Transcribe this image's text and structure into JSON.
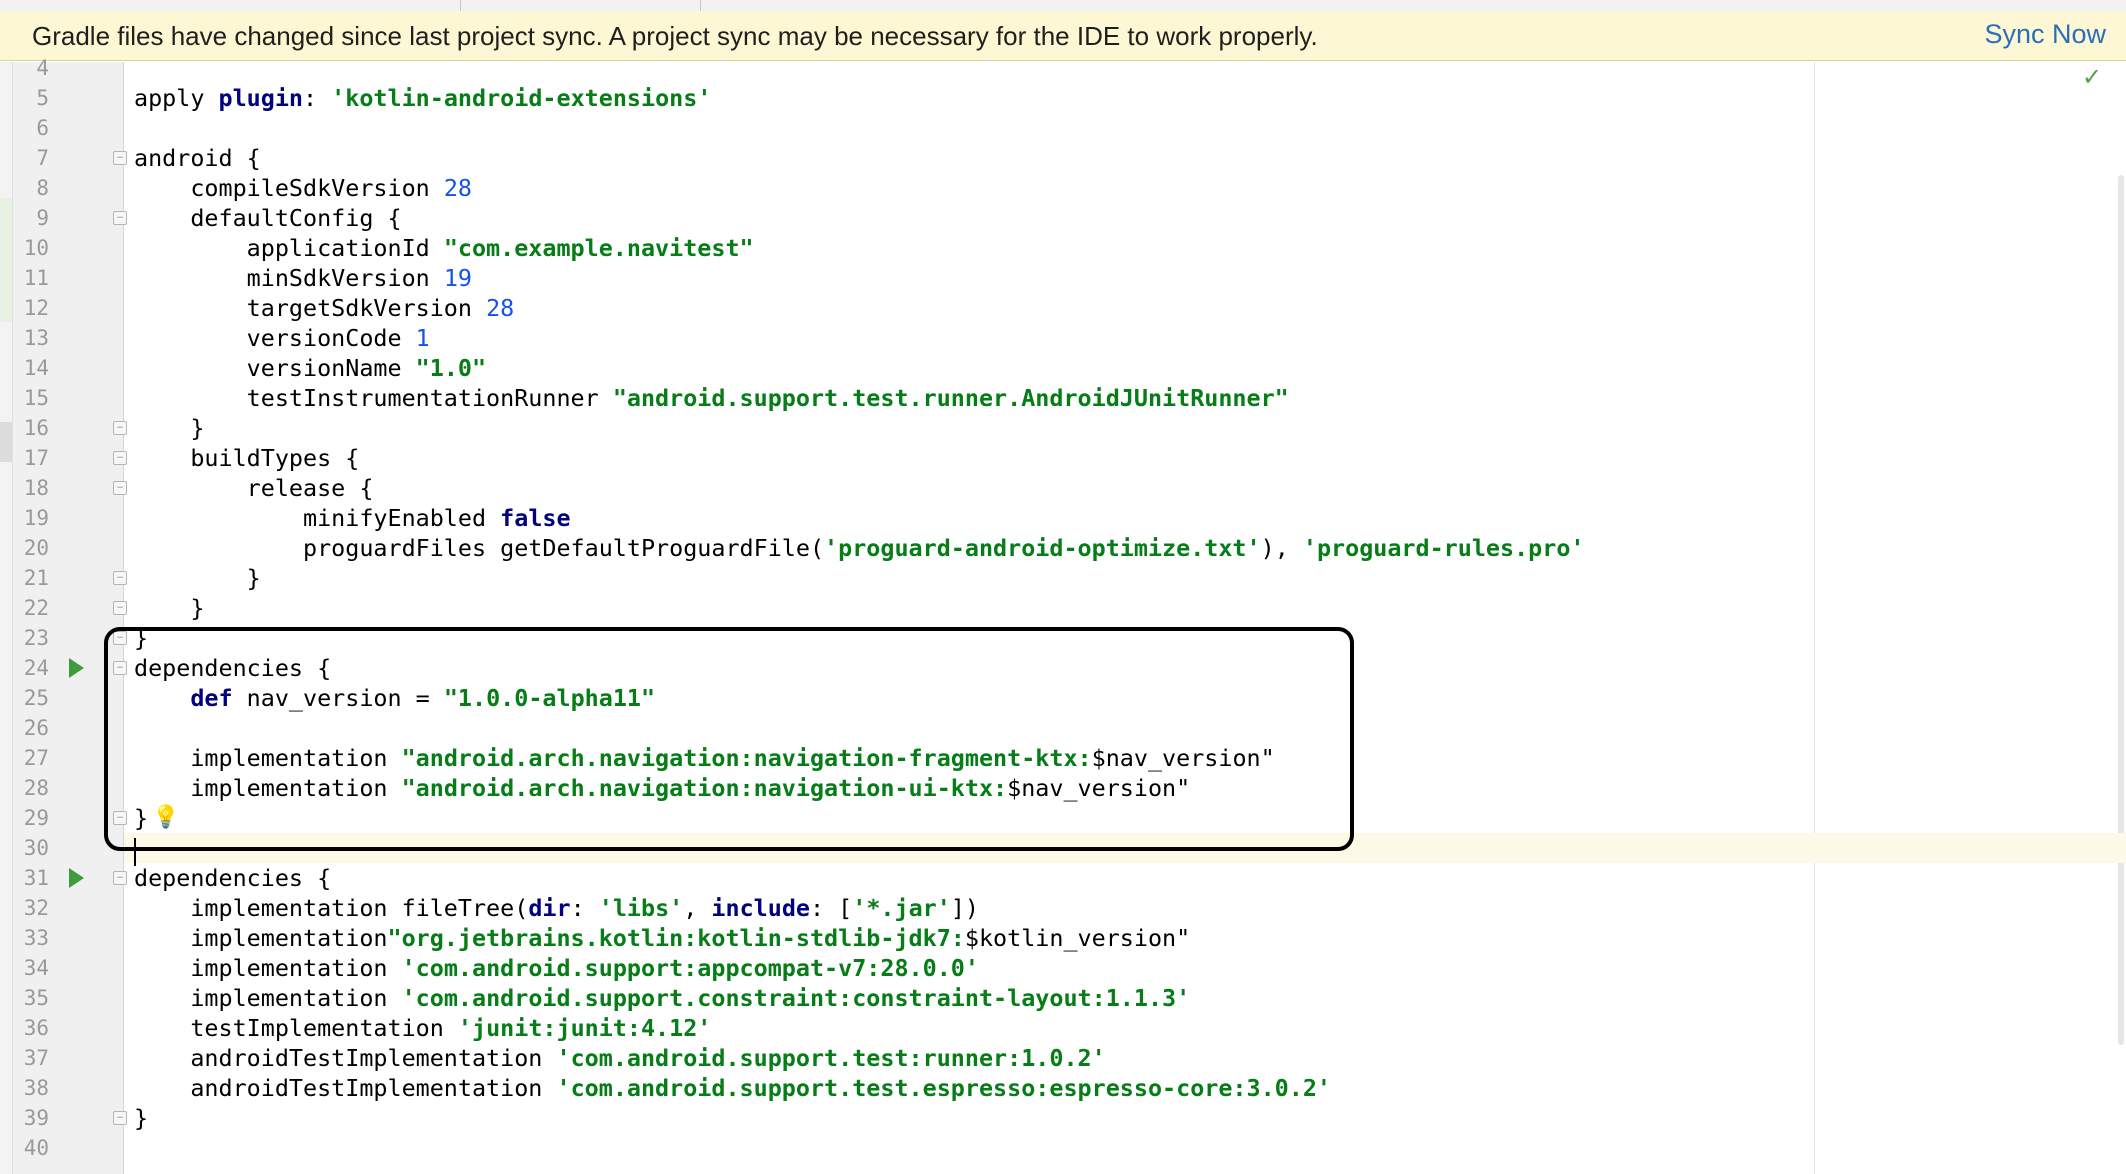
{
  "banner": {
    "message": "Gradle files have changed since last project sync. A project sync may be necessary for the IDE to work properly.",
    "action_label": "Sync Now"
  },
  "colors": {
    "banner_background": "#fdf8d3",
    "link": "#2a6ebb",
    "keyword": "#000080",
    "string": "#067d17",
    "number": "#1750eb",
    "gutter_background": "#f0f0f0",
    "current_line": "#fcfae6"
  },
  "icons": {
    "fold": "fold-marker-icon",
    "run": "run-gutter-icon",
    "bulb": "lightbulb-icon",
    "check": "check-icon"
  },
  "editor": {
    "current_line": "30",
    "lines": [
      {
        "n": "4",
        "tokens": []
      },
      {
        "n": "5",
        "tokens": [
          [
            "p",
            "apply "
          ],
          [
            "k",
            "plugin"
          ],
          [
            "p",
            ": "
          ],
          [
            "s",
            "'kotlin-android-extensions'"
          ]
        ]
      },
      {
        "n": "6",
        "tokens": []
      },
      {
        "n": "7",
        "fold": true,
        "tokens": [
          [
            "p",
            "android {"
          ]
        ]
      },
      {
        "n": "8",
        "tokens": [
          [
            "p",
            "    compileSdkVersion "
          ],
          [
            "n",
            "28"
          ]
        ]
      },
      {
        "n": "9",
        "fold": true,
        "tokens": [
          [
            "p",
            "    defaultConfig {"
          ]
        ]
      },
      {
        "n": "10",
        "tokens": [
          [
            "p",
            "        applicationId "
          ],
          [
            "s",
            "\"com.example.navitest\""
          ]
        ]
      },
      {
        "n": "11",
        "tokens": [
          [
            "p",
            "        minSdkVersion "
          ],
          [
            "n",
            "19"
          ]
        ]
      },
      {
        "n": "12",
        "tokens": [
          [
            "p",
            "        targetSdkVersion "
          ],
          [
            "n",
            "28"
          ]
        ]
      },
      {
        "n": "13",
        "tokens": [
          [
            "p",
            "        versionCode "
          ],
          [
            "n",
            "1"
          ]
        ]
      },
      {
        "n": "14",
        "tokens": [
          [
            "p",
            "        versionName "
          ],
          [
            "s",
            "\"1.0\""
          ]
        ]
      },
      {
        "n": "15",
        "tokens": [
          [
            "p",
            "        testInstrumentationRunner "
          ],
          [
            "s",
            "\"android.support.test.runner.AndroidJUnitRunner\""
          ]
        ]
      },
      {
        "n": "16",
        "fold": true,
        "tokens": [
          [
            "p",
            "    }"
          ]
        ]
      },
      {
        "n": "17",
        "fold": true,
        "tokens": [
          [
            "p",
            "    buildTypes {"
          ]
        ]
      },
      {
        "n": "18",
        "fold": true,
        "tokens": [
          [
            "p",
            "        release {"
          ]
        ]
      },
      {
        "n": "19",
        "tokens": [
          [
            "p",
            "            minifyEnabled "
          ],
          [
            "k",
            "false"
          ]
        ]
      },
      {
        "n": "20",
        "tokens": [
          [
            "p",
            "            proguardFiles getDefaultProguardFile("
          ],
          [
            "s",
            "'proguard-android-optimize.txt'"
          ],
          [
            "p",
            "), "
          ],
          [
            "s",
            "'proguard-rules.pro'"
          ]
        ]
      },
      {
        "n": "21",
        "fold": true,
        "tokens": [
          [
            "p",
            "        }"
          ]
        ]
      },
      {
        "n": "22",
        "fold": true,
        "tokens": [
          [
            "p",
            "    }"
          ]
        ]
      },
      {
        "n": "23",
        "fold": true,
        "tokens": [
          [
            "p",
            "}"
          ]
        ]
      },
      {
        "n": "24",
        "fold": true,
        "run": true,
        "tokens": [
          [
            "p",
            "dependencies {"
          ]
        ]
      },
      {
        "n": "25",
        "tokens": [
          [
            "p",
            "    "
          ],
          [
            "k",
            "def"
          ],
          [
            "p",
            " nav_version = "
          ],
          [
            "s",
            "\"1.0.0-alpha11\""
          ]
        ]
      },
      {
        "n": "26",
        "tokens": []
      },
      {
        "n": "27",
        "tokens": [
          [
            "p",
            "    implementation "
          ],
          [
            "s",
            "\"android.arch.navigation:navigation-fragment-ktx:"
          ],
          [
            "p",
            "$nav_version\""
          ]
        ]
      },
      {
        "n": "28",
        "tokens": [
          [
            "p",
            "    implementation "
          ],
          [
            "s",
            "\"android.arch.navigation:navigation-ui-ktx:"
          ],
          [
            "p",
            "$nav_version\""
          ]
        ]
      },
      {
        "n": "29",
        "fold": true,
        "bulb": true,
        "tokens": [
          [
            "p",
            "}"
          ]
        ]
      },
      {
        "n": "30",
        "tokens": []
      },
      {
        "n": "31",
        "fold": true,
        "run": true,
        "tokens": [
          [
            "p",
            "dependencies {"
          ]
        ]
      },
      {
        "n": "32",
        "tokens": [
          [
            "p",
            "    implementation fileTree("
          ],
          [
            "k",
            "dir"
          ],
          [
            "p",
            ": "
          ],
          [
            "s",
            "'libs'"
          ],
          [
            "p",
            ", "
          ],
          [
            "k",
            "include"
          ],
          [
            "p",
            ": ["
          ],
          [
            "s",
            "'*.jar'"
          ],
          [
            "p",
            "])"
          ]
        ]
      },
      {
        "n": "33",
        "tokens": [
          [
            "p",
            "    implementation"
          ],
          [
            "s",
            "\"org.jetbrains.kotlin:kotlin-stdlib-jdk7:"
          ],
          [
            "p",
            "$kotlin_version\""
          ]
        ]
      },
      {
        "n": "34",
        "tokens": [
          [
            "p",
            "    implementation "
          ],
          [
            "s",
            "'com.android.support:appcompat-v7:28.0.0'"
          ]
        ]
      },
      {
        "n": "35",
        "tokens": [
          [
            "p",
            "    implementation "
          ],
          [
            "s",
            "'com.android.support.constraint:constraint-layout:1.1.3'"
          ]
        ]
      },
      {
        "n": "36",
        "tokens": [
          [
            "p",
            "    testImplementation "
          ],
          [
            "s",
            "'junit:junit:4.12'"
          ]
        ]
      },
      {
        "n": "37",
        "tokens": [
          [
            "p",
            "    androidTestImplementation "
          ],
          [
            "s",
            "'com.android.support.test:runner:1.0.2'"
          ]
        ]
      },
      {
        "n": "38",
        "tokens": [
          [
            "p",
            "    androidTestImplementation "
          ],
          [
            "s",
            "'com.android.support.test.espresso:espresso-core:3.0.2'"
          ]
        ]
      },
      {
        "n": "39",
        "fold": true,
        "tokens": [
          [
            "p",
            "}"
          ]
        ]
      },
      {
        "n": "40",
        "tokens": []
      }
    ]
  }
}
